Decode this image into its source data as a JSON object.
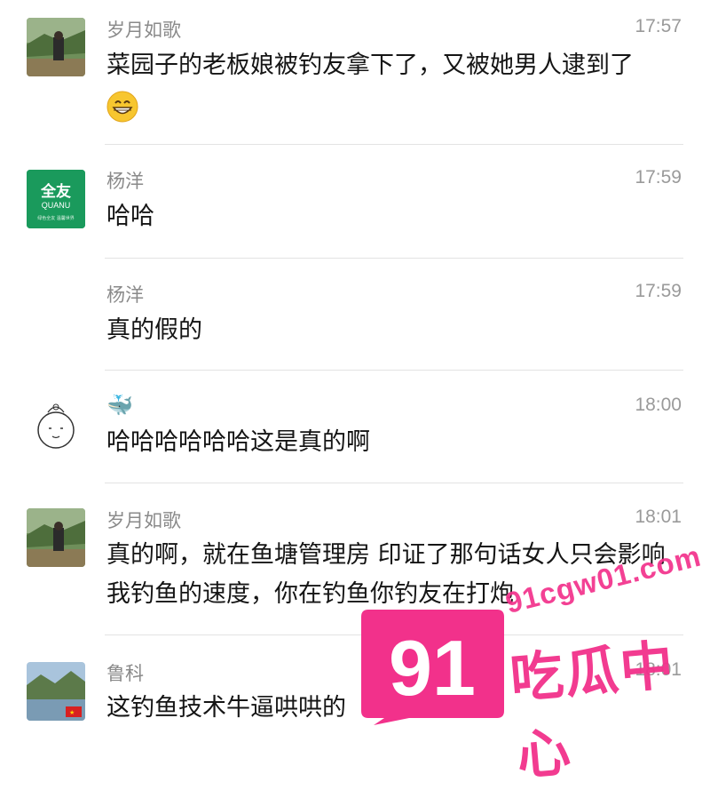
{
  "messages": [
    {
      "sender": "岁月如歌",
      "time": "17:57",
      "text": "菜园子的老板娘被钓友拿下了，又被她男人逮到了",
      "avatar": "landscape-photo-avatar",
      "emoji": "grinning-face-emoji"
    },
    {
      "sender": "杨洋",
      "time": "17:59",
      "text": "哈哈",
      "avatar": "quanu-logo-avatar",
      "avatar_text": {
        "main": "全友",
        "sub": "QUANU",
        "tiny": "绿色全友 温馨世界"
      }
    },
    {
      "sender": "杨洋",
      "time": "17:59",
      "text": "真的假的",
      "avatar": null
    },
    {
      "sender": "🐳",
      "time": "18:00",
      "text": "哈哈哈哈哈哈这是真的啊",
      "avatar": "doodle-face-avatar"
    },
    {
      "sender": "岁月如歌",
      "time": "18:01",
      "text": "真的啊，就在鱼塘管理房   印证了那句话女人只会影响我钓鱼的速度，你在钓鱼你钓友在打炮",
      "avatar": "landscape-photo-avatar"
    },
    {
      "sender": "鲁科",
      "time": "18:01",
      "text": "这钓鱼技术牛逼哄哄的",
      "avatar": "river-photo-avatar"
    }
  ],
  "watermark": {
    "number": "91",
    "url": "91cgw01.com",
    "name": "吃瓜中心"
  },
  "colors": {
    "accent": "#f2318b",
    "quanu_green": "#1a9a5c",
    "text": "#151515",
    "meta": "#8a8a8a"
  }
}
